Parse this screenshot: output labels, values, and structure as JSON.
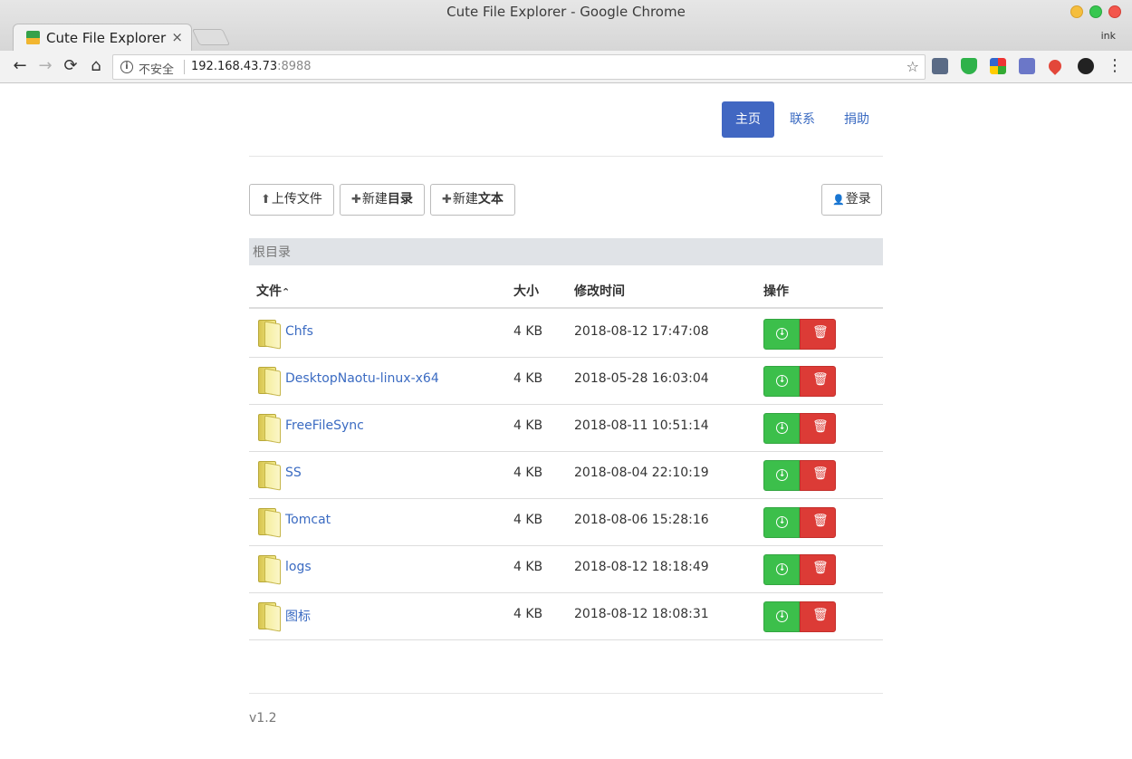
{
  "window": {
    "title": "Cute File Explorer - Google Chrome",
    "user": "ink"
  },
  "tab": {
    "title": "Cute File Explorer",
    "close": "×"
  },
  "toolbar": {
    "back": "←",
    "forward": "→",
    "reload": "⟳",
    "home": "⌂",
    "security_label": "不安全",
    "url_host": "192.168.43.73",
    "url_port": ":8988",
    "star": "☆",
    "menu": "⋮"
  },
  "nav": {
    "home": "主页",
    "contact": "联系",
    "donate": "捐助"
  },
  "actions": {
    "upload_icon": "⬆",
    "upload": "上传文件",
    "new_prefix": "新建",
    "new_dir": "目录",
    "new_text": "文本",
    "plus": "✚",
    "user_icon": "👤",
    "login": "登录"
  },
  "breadcrumb": "根目录",
  "table": {
    "headers": {
      "file": "文件",
      "sort": "⌃",
      "size": "大小",
      "modified": "修改时间",
      "ops": "操作"
    },
    "rows": [
      {
        "name": "Chfs",
        "size": "4 KB",
        "modified": "2018-08-12 17:47:08"
      },
      {
        "name": "DesktopNaotu-linux-x64",
        "size": "4 KB",
        "modified": "2018-05-28 16:03:04"
      },
      {
        "name": "FreeFileSync",
        "size": "4 KB",
        "modified": "2018-08-11 10:51:14"
      },
      {
        "name": "SS",
        "size": "4 KB",
        "modified": "2018-08-04 22:10:19"
      },
      {
        "name": "Tomcat",
        "size": "4 KB",
        "modified": "2018-08-06 15:28:16"
      },
      {
        "name": "logs",
        "size": "4 KB",
        "modified": "2018-08-12 18:18:49"
      },
      {
        "name": "图标",
        "size": "4 KB",
        "modified": "2018-08-12 18:08:31"
      }
    ]
  },
  "footer": {
    "version": "v1.2"
  },
  "colors": {
    "primary": "#4167c2",
    "link": "#3b6bc2",
    "success": "#3cbf4b",
    "danger": "#dc3b36"
  }
}
